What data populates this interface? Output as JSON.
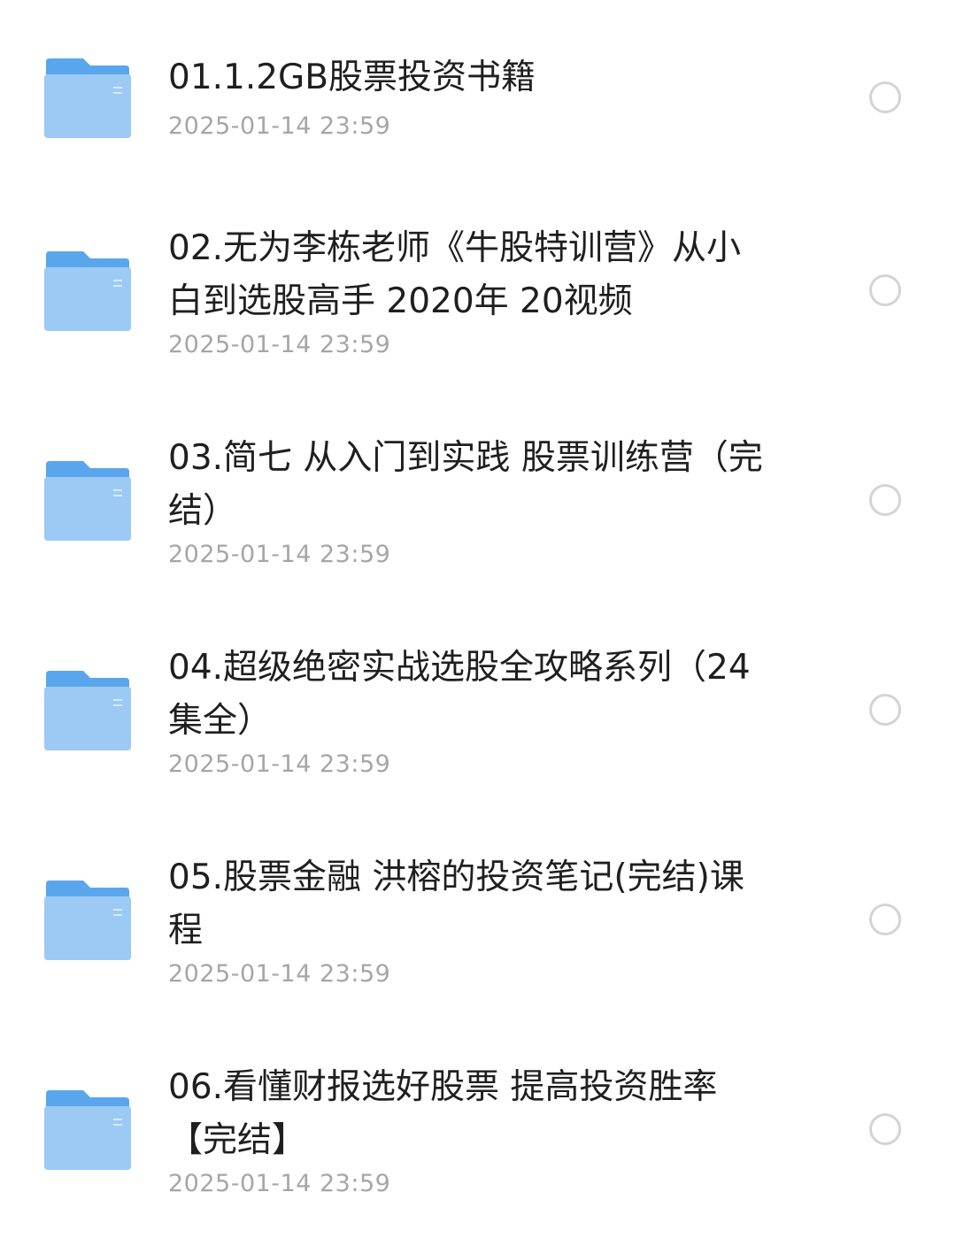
{
  "colors": {
    "folder_light": "#b9dcfb",
    "folder_mid": "#8fc3f5",
    "folder_dark": "#5aa6ec",
    "title_text": "#1f1f1f",
    "date_text": "#a6a6a6",
    "radio_border": "#d4d4d4"
  },
  "files": [
    {
      "icon": "folder-icon",
      "name": "01.1.2GB股票投资书籍",
      "date": "2025-01-14 23:59"
    },
    {
      "icon": "folder-icon",
      "name": "02.无为李栋老师《牛股特训营》从小白到选股高手 2020年 20视频",
      "date": "2025-01-14 23:59"
    },
    {
      "icon": "folder-icon",
      "name": "03.简七 从入门到实践 股票训练营（完结）",
      "date": "2025-01-14 23:59"
    },
    {
      "icon": "folder-icon",
      "name": "04.超级绝密实战选股全攻略系列（24集全）",
      "date": "2025-01-14 23:59"
    },
    {
      "icon": "folder-icon",
      "name": "05.股票金融 洪榕的投资笔记(完结)课程",
      "date": "2025-01-14 23:59"
    },
    {
      "icon": "folder-icon",
      "name": "06.看懂财报选好股票 提高投资胜率【完结】",
      "date": "2025-01-14 23:59"
    }
  ]
}
